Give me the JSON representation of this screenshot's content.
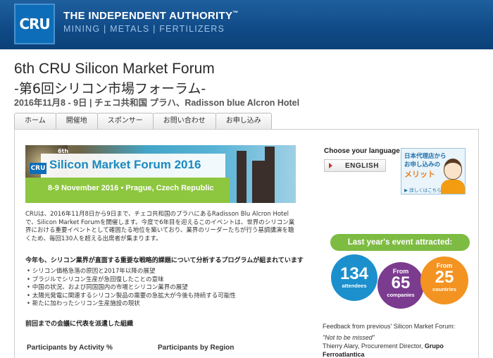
{
  "header": {
    "logo_text": "CRU",
    "brand_line1": "THE INDEPENDENT AUTHORITY",
    "brand_tm": "™",
    "brand_line2": "MINING | METALS | FERTILIZERS",
    "bg_color": "#0f4a86"
  },
  "page": {
    "title_en": "6th CRU Silicon Market Forum",
    "title_jp": "-第6回シリコン市場フォーラム-",
    "subtitle": "2016年11月8 - 9日 | チェコ共和国 プラハ、Radisson blue Alcron Hotel"
  },
  "nav": {
    "tabs": [
      {
        "label": "ホーム"
      },
      {
        "label": "開催地"
      },
      {
        "label": "スポンサー"
      },
      {
        "label": "お問い合わせ"
      },
      {
        "label": "お申し込み"
      }
    ]
  },
  "banner": {
    "edition": "6th",
    "logo": "CRU",
    "title": "Silicon Market Forum 2016",
    "date_place": "8-9 November 2016 • Prague, Czech Republic"
  },
  "main": {
    "intro": "CRUは、2016年11月8日から9日まで、チェコ共和国のプラハにあるRadisson Blu Alcron Hotelで、Silicon Market Forumを開催します。今度で6年目を迎えるこのイベントは、世界のシリコン業界における重要イベントとして確固たる地位を築いており、業界のリーダーたちが行う基調講演を聴くため、毎回130人を超える出席者が集まります。",
    "lead": "今年も、シリコン業界が直面する重要な戦略的課題について分析するプログラムが組まれています",
    "bullets": [
      "シリコン価格急落の原因と2017年以降の展望",
      "ブラジルでシリコン生産が急回復したことの意味",
      "中国の状況、および同国国内の市場とシリコン業界の展望",
      "太陽光発電に関連するシリコン製品の需要の急拡大が今後も持続する可能性",
      "新たに加わったシリコン生産施設の現状"
    ],
    "section_head": "前回までの会議に代表を派遣した組織",
    "chart_label_activity": "Participants by Activity %",
    "chart_label_region": "Participants by Region"
  },
  "sidebar": {
    "language_label": "Choose your language",
    "language_button": "ENGLISH",
    "agent_line1": "日本代理店から",
    "agent_line2": "お申し込みの",
    "agent_line3": "メリット",
    "agent_link": "▶ 詳しくはこちら",
    "attracted_label": "Last year's event attracted:",
    "stats": [
      {
        "prefix": "",
        "value": "134",
        "caption": "attendees",
        "color": "#1c90cd"
      },
      {
        "prefix": "From",
        "value": "65",
        "caption": "companies",
        "color": "#7b3b8f"
      },
      {
        "prefix": "From",
        "value": "25",
        "caption": "countries",
        "color": "#f39321"
      }
    ],
    "feedback_label": "Feedback from previous' Silicon Market Forum:",
    "quote": "\"Not to be missed\"",
    "quote_author": "Thierry Alary, Procurement Director,",
    "quote_company": "Grupo Ferroatlantica"
  }
}
